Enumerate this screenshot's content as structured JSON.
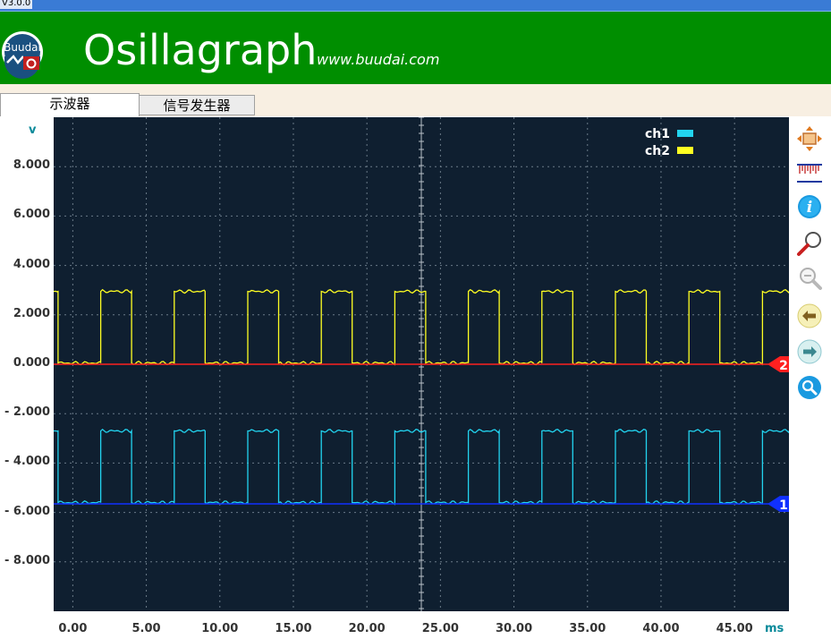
{
  "window": {
    "version": "V3.0.0"
  },
  "header": {
    "logo_text": "Buudai",
    "title": "Osillagraph",
    "url": "www.buudai.com"
  },
  "tabs": [
    {
      "label": "示波器",
      "active": true
    },
    {
      "label": "信号发生器",
      "active": false
    }
  ],
  "toolbar": {
    "icons": [
      "move-icon",
      "ruler-icon",
      "info-icon",
      "zoom-in-icon",
      "zoom-out-icon",
      "arrow-left-icon",
      "arrow-right-icon",
      "search-icon"
    ]
  },
  "colors": {
    "banner": "#008e00",
    "plot_bg": "#0f1f30",
    "ch1": "#22d4f0",
    "ch2": "#ffff22",
    "ch2_ref": "#ff2020",
    "ch1_ref": "#1030ff"
  },
  "chart_data": {
    "type": "line",
    "xlabel": "ms",
    "ylabel": "v",
    "x_ticks": [
      "0.00",
      "5.00",
      "10.00",
      "15.00",
      "20.00",
      "25.00",
      "30.00",
      "35.00",
      "40.00",
      "45.00"
    ],
    "y_ticks": [
      "8.000",
      "6.000",
      "4.000",
      "2.000",
      "0.000",
      "- 2.000",
      "- 4.000",
      "- 6.000",
      "- 8.000"
    ],
    "xlim": [
      -1.3,
      48.7
    ],
    "ylim": [
      -10,
      10
    ],
    "grid": true,
    "legend_position": "top-right",
    "series": [
      {
        "name": "ch1",
        "color": "#22d4f0",
        "high": -2.7,
        "low": -5.6,
        "period_ms": 5.0,
        "first_rise_ms": 1.9,
        "high_duration_ms": 2.1
      },
      {
        "name": "ch2",
        "color": "#ffff22",
        "high": 2.95,
        "low": 0.05,
        "period_ms": 5.0,
        "first_rise_ms": 1.9,
        "high_duration_ms": 2.1
      }
    ],
    "reference_markers": [
      {
        "label": "2",
        "level": 0.0,
        "color": "#ff2020"
      },
      {
        "label": "1",
        "level": -5.65,
        "color": "#1030ff"
      }
    ]
  }
}
